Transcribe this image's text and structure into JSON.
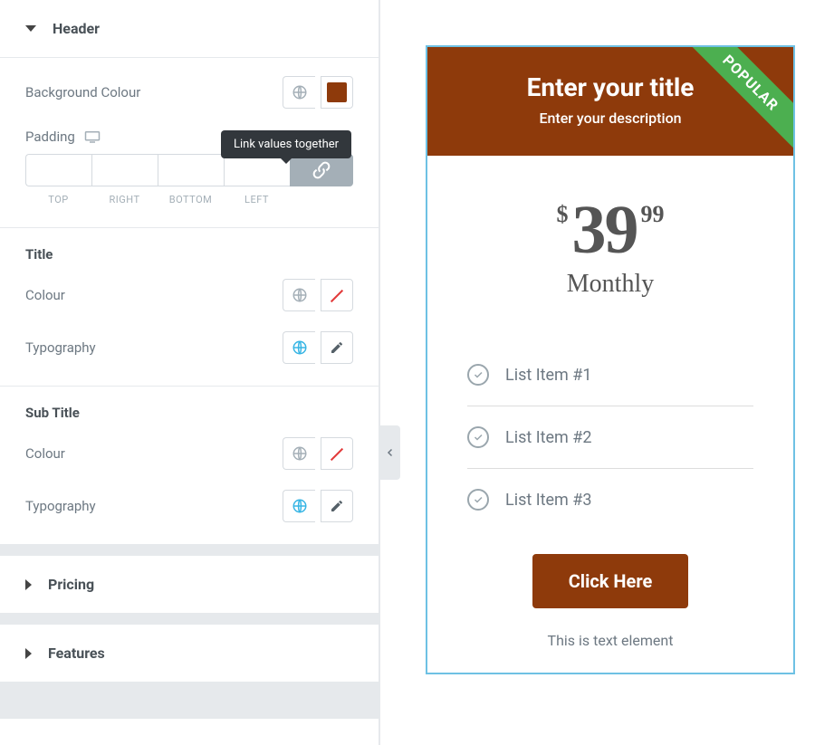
{
  "sidebar": {
    "sections": {
      "header": {
        "title": "Header",
        "bg_label": "Background Colour",
        "bg_color": "#8e3a0b",
        "padding_label": "Padding",
        "padding_cells": {
          "top": "TOP",
          "right": "RIGHT",
          "bottom": "BOTTOM",
          "left": "LEFT"
        },
        "tooltip": "Link values together",
        "title_group": {
          "heading": "Title",
          "colour_label": "Colour",
          "typography_label": "Typography"
        },
        "subtitle_group": {
          "heading": "Sub Title",
          "colour_label": "Colour",
          "typography_label": "Typography"
        }
      },
      "pricing": {
        "title": "Pricing"
      },
      "features": {
        "title": "Features"
      }
    }
  },
  "preview": {
    "ribbon": "POPULAR",
    "title": "Enter your title",
    "description": "Enter your description",
    "currency": "$",
    "amount": "39",
    "cents": "99",
    "period": "Monthly",
    "features": [
      "List Item #1",
      "List Item #2",
      "List Item #3"
    ],
    "cta": "Click Here",
    "footer": "This is text element"
  },
  "colors": {
    "brand": "#8e3a0b",
    "ribbon": "#4caf50",
    "outline": "#6ec1e4"
  }
}
